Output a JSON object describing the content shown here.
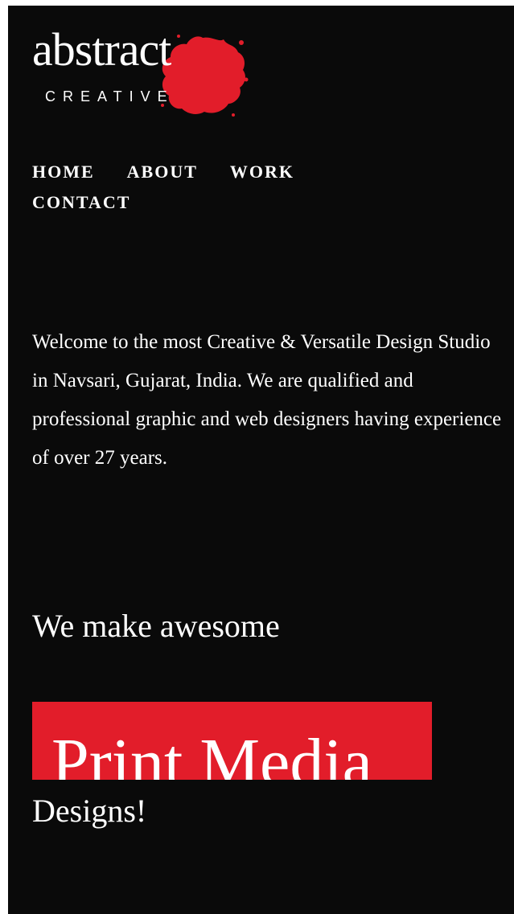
{
  "logo": {
    "word": "abstract",
    "subtitle": "CREATIVE",
    "splat_color": "#e21d2a"
  },
  "nav": {
    "items": [
      "HOME",
      "ABOUT",
      "WORK",
      "CONTACT"
    ]
  },
  "intro": {
    "text": "Welcome to the most Creative & Versatile Design Studio in Navsari, Gujarat, India. We are qualified and professional graphic and web designers having experience of over 27 years."
  },
  "tagline": {
    "prefix": "We make awesome",
    "highlight": "Print Media",
    "suffix": "Designs!"
  },
  "colors": {
    "background": "#0a0a0a",
    "accent": "#e21d2a",
    "text": "#ffffff"
  }
}
